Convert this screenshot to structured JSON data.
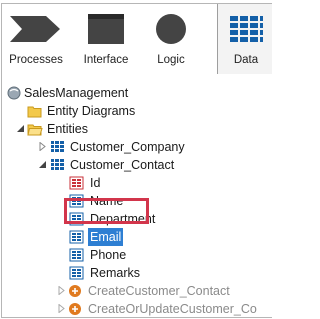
{
  "toolbar": {
    "tabs": [
      {
        "label": "Processes",
        "icon": "processes-icon"
      },
      {
        "label": "Interface",
        "icon": "interface-icon"
      },
      {
        "label": "Logic",
        "icon": "logic-icon"
      },
      {
        "label": "Data",
        "icon": "data-table-icon",
        "selected": true
      }
    ]
  },
  "tree": {
    "root": "SalesManagement",
    "entity_diagrams": "Entity Diagrams",
    "entities": "Entities",
    "customer_company": "Customer_Company",
    "customer_contact": "Customer_Contact",
    "attributes": [
      "Id",
      "Name",
      "Department",
      "Email",
      "Phone",
      "Remarks"
    ],
    "selected_attribute": "Email",
    "actions": [
      "CreateCustomer_Contact",
      "CreateOrUpdateCustomer_Co"
    ]
  },
  "colors": {
    "selection": "#2e7fd3",
    "highlight_border": "#d2354b",
    "data_icon_blue": "#1460a8",
    "folder_yellow": "#f3c94a"
  }
}
